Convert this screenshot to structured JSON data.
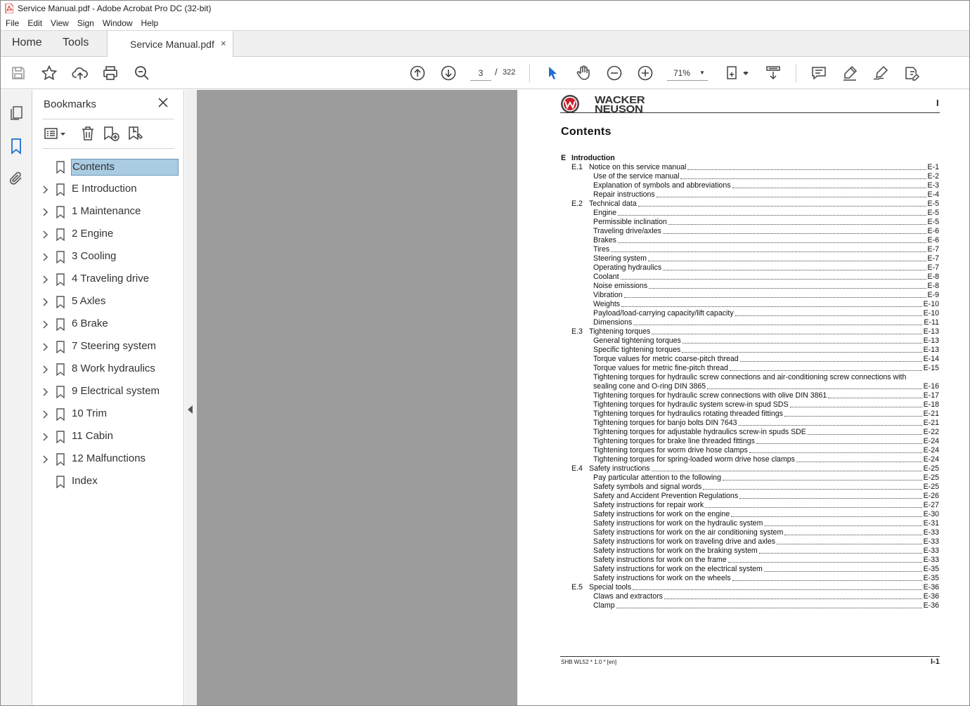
{
  "window": {
    "title": "Service Manual.pdf - Adobe Acrobat Pro DC (32-bit)"
  },
  "menu": [
    "File",
    "Edit",
    "View",
    "Sign",
    "Window",
    "Help"
  ],
  "tabs": {
    "home": "Home",
    "tools": "Tools",
    "document": "Service Manual.pdf",
    "close": "×"
  },
  "toolbar": {
    "page_current": "3",
    "page_sep": "/",
    "page_total": "322",
    "zoom": "71%"
  },
  "bookmarks": {
    "title": "Bookmarks",
    "items": [
      {
        "label": "Contents",
        "expandable": false,
        "selected": true
      },
      {
        "label": "E Introduction",
        "expandable": true
      },
      {
        "label": "1 Maintenance",
        "expandable": true
      },
      {
        "label": "2 Engine",
        "expandable": true
      },
      {
        "label": "3 Cooling",
        "expandable": true
      },
      {
        "label": "4 Traveling drive",
        "expandable": true
      },
      {
        "label": "5 Axles",
        "expandable": true
      },
      {
        "label": "6 Brake",
        "expandable": true
      },
      {
        "label": "7 Steering system",
        "expandable": true
      },
      {
        "label": "8 Work hydraulics",
        "expandable": true
      },
      {
        "label": "9 Electrical system",
        "expandable": true
      },
      {
        "label": "10 Trim",
        "expandable": true
      },
      {
        "label": "11 Cabin",
        "expandable": true
      },
      {
        "label": "12 Malfunctions",
        "expandable": true
      },
      {
        "label": "Index",
        "expandable": false
      }
    ]
  },
  "document": {
    "logo_line1": "WACKER",
    "logo_line2": "NEUSON",
    "page_marker": "I",
    "heading": "Contents",
    "toc": [
      {
        "level": 0,
        "num": "E",
        "title": "Introduction",
        "page": ""
      },
      {
        "level": 1,
        "num": "E.1",
        "title": "Notice on this service manual",
        "page": "E-1"
      },
      {
        "level": 2,
        "num": "",
        "title": "Use of the service manual",
        "page": "E-2"
      },
      {
        "level": 2,
        "num": "",
        "title": "Explanation of symbols and abbreviations",
        "page": "E-3"
      },
      {
        "level": 2,
        "num": "",
        "title": "Repair instructions",
        "page": "E-4"
      },
      {
        "level": 1,
        "num": "E.2",
        "title": "Technical data",
        "page": "E-5"
      },
      {
        "level": 2,
        "num": "",
        "title": "Engine",
        "page": "E-5"
      },
      {
        "level": 2,
        "num": "",
        "title": "Permissible inclination",
        "page": "E-5"
      },
      {
        "level": 2,
        "num": "",
        "title": "Traveling drive/axles",
        "page": "E-6"
      },
      {
        "level": 2,
        "num": "",
        "title": "Brakes",
        "page": "E-6"
      },
      {
        "level": 2,
        "num": "",
        "title": "Tires",
        "page": "E-7"
      },
      {
        "level": 2,
        "num": "",
        "title": "Steering system",
        "page": "E-7"
      },
      {
        "level": 2,
        "num": "",
        "title": "Operating hydraulics",
        "page": "E-7"
      },
      {
        "level": 2,
        "num": "",
        "title": "Coolant",
        "page": "E-8"
      },
      {
        "level": 2,
        "num": "",
        "title": "Noise emissions",
        "page": "E-8"
      },
      {
        "level": 2,
        "num": "",
        "title": "Vibration",
        "page": "E-9"
      },
      {
        "level": 2,
        "num": "",
        "title": "Weights",
        "page": "E-10"
      },
      {
        "level": 2,
        "num": "",
        "title": "Payload/load-carrying capacity/lift capacity",
        "page": "E-10"
      },
      {
        "level": 2,
        "num": "",
        "title": "Dimensions",
        "page": "E-11"
      },
      {
        "level": 1,
        "num": "E.3",
        "title": "Tightening torques",
        "page": "E-13"
      },
      {
        "level": 2,
        "num": "",
        "title": "General tightening torques",
        "page": "E-13"
      },
      {
        "level": 2,
        "num": "",
        "title": "Specific tightening torques",
        "page": "E-13"
      },
      {
        "level": 2,
        "num": "",
        "title": "Torque values for metric coarse-pitch thread",
        "page": "E-14"
      },
      {
        "level": 2,
        "num": "",
        "title": "Torque values for metric fine-pitch thread",
        "page": "E-15"
      },
      {
        "level": 2,
        "num": "",
        "title": "Tightening torques for hydraulic screw connections and air-conditioning screw connections with",
        "page": "",
        "nodots": true
      },
      {
        "level": 2,
        "num": "",
        "title": "sealing cone and O-ring DIN 3865",
        "page": "E-16"
      },
      {
        "level": 2,
        "num": "",
        "title": "Tightening torques for hydraulic screw connections with olive DIN 3861",
        "page": "E-17"
      },
      {
        "level": 2,
        "num": "",
        "title": "Tightening torques for hydraulic system screw-in spud SDS",
        "page": "E-18"
      },
      {
        "level": 2,
        "num": "",
        "title": "Tightening torques for hydraulics rotating threaded fittings",
        "page": "E-21"
      },
      {
        "level": 2,
        "num": "",
        "title": "Tightening torques for banjo bolts DIN 7643",
        "page": "E-21"
      },
      {
        "level": 2,
        "num": "",
        "title": "Tightening torques for adjustable hydraulics screw-in spuds SDE",
        "page": "E-22"
      },
      {
        "level": 2,
        "num": "",
        "title": "Tightening torques for brake line threaded fittings",
        "page": "E-24"
      },
      {
        "level": 2,
        "num": "",
        "title": "Tightening torques for worm drive hose clamps",
        "page": "E-24"
      },
      {
        "level": 2,
        "num": "",
        "title": "Tightening torques for spring-loaded worm drive hose clamps",
        "page": "E-24"
      },
      {
        "level": 1,
        "num": "E.4",
        "title": "Safety instructions",
        "page": "E-25"
      },
      {
        "level": 2,
        "num": "",
        "title": "Pay particular attention to the following",
        "page": "E-25"
      },
      {
        "level": 2,
        "num": "",
        "title": "Safety symbols and signal words",
        "page": "E-25"
      },
      {
        "level": 2,
        "num": "",
        "title": "Safety and Accident Prevention Regulations",
        "page": "E-26"
      },
      {
        "level": 2,
        "num": "",
        "title": "Safety instructions for repair work",
        "page": "E-27"
      },
      {
        "level": 2,
        "num": "",
        "title": "Safety instructions for work on the engine",
        "page": "E-30"
      },
      {
        "level": 2,
        "num": "",
        "title": "Safety instructions for work on the hydraulic system",
        "page": "E-31"
      },
      {
        "level": 2,
        "num": "",
        "title": "Safety instructions for work on the air conditioning system",
        "page": "E-33"
      },
      {
        "level": 2,
        "num": "",
        "title": "Safety instructions for work on traveling drive and axles",
        "page": "E-33"
      },
      {
        "level": 2,
        "num": "",
        "title": "Safety instructions for work on the braking system",
        "page": "E-33"
      },
      {
        "level": 2,
        "num": "",
        "title": "Safety instructions for work on the frame",
        "page": "E-33"
      },
      {
        "level": 2,
        "num": "",
        "title": "Safety instructions for work on the electrical system",
        "page": "E-35"
      },
      {
        "level": 2,
        "num": "",
        "title": "Safety instructions for work on the wheels",
        "page": "E-35"
      },
      {
        "level": 1,
        "num": "E.5",
        "title": "Special tools",
        "page": "E-36"
      },
      {
        "level": 2,
        "num": "",
        "title": "Claws and extractors",
        "page": "E-36"
      },
      {
        "level": 2,
        "num": "",
        "title": "Clamp",
        "page": "E-36"
      }
    ],
    "footer_left": "SHB WL52 *  1.0 * [en]",
    "footer_right": "I-1"
  },
  "colors": {
    "selection": "#a9cce3",
    "doc_bg": "#9c9c9c",
    "pdf_red": "#d3281e",
    "pointer_blue": "#1f6fd1"
  }
}
